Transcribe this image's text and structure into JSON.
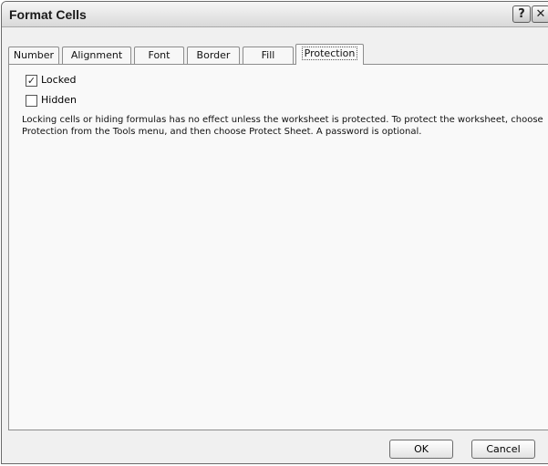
{
  "window": {
    "title": "Format Cells",
    "help_symbol": "?",
    "close_symbol": "✕"
  },
  "tabs": [
    {
      "label": "Number"
    },
    {
      "label": "Alignment"
    },
    {
      "label": "Font"
    },
    {
      "label": "Border"
    },
    {
      "label": "Fill"
    },
    {
      "label": "Protection",
      "active": true
    }
  ],
  "options": {
    "locked": {
      "label": "Locked",
      "checked": true,
      "check_symbol": "✓"
    },
    "hidden": {
      "label": "Hidden",
      "checked": false,
      "check_symbol": ""
    }
  },
  "description": "Locking cells or hiding formulas has no effect unless the worksheet is protected. To protect the worksheet, choose Protection from the Tools menu, and then choose Protect Sheet. A password is optional.",
  "buttons": {
    "ok": "OK",
    "cancel": "Cancel"
  }
}
